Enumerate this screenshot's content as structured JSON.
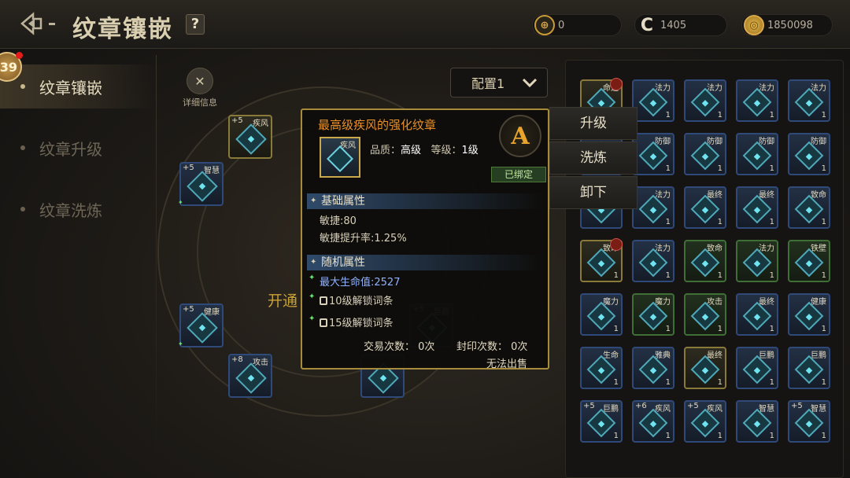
{
  "header": {
    "title": "纹章镶嵌",
    "help_label": "?",
    "currencies": [
      {
        "icon": "target-coin-icon",
        "value": "0"
      },
      {
        "icon": "c-coin-icon",
        "value": "1405"
      },
      {
        "icon": "gold-coin-icon",
        "value": "1850098"
      }
    ]
  },
  "sidebar": {
    "level_badge": "39",
    "items": [
      {
        "label": "纹章镶嵌",
        "active": true
      },
      {
        "label": "纹章升级",
        "active": false
      },
      {
        "label": "纹章洗炼",
        "active": false
      }
    ]
  },
  "main": {
    "detail_label": "详细信息",
    "config_value": "配置1",
    "unlock_text": "开通",
    "slots": [
      {
        "plus": "+5",
        "tag": "疾风"
      },
      {
        "plus": "+5",
        "tag": "智慧"
      },
      {
        "plus": "+5",
        "tag": "健康"
      },
      {
        "plus": "+8",
        "tag": "攻击"
      },
      {
        "plus": "+5",
        "tag": "巨鹏"
      }
    ]
  },
  "tooltip": {
    "name": "最高级疾风的强化纹章",
    "icon_tag": "疾风",
    "quality_label": "品质：",
    "quality_value": "高级",
    "level_label": "等级：",
    "level_value": "1级",
    "grade": "A",
    "bound": "已绑定",
    "base_title": "基础属性",
    "base_lines": [
      "敏捷:80",
      "敏捷提升率:1.25%"
    ],
    "random_title": "随机属性",
    "random_lines": [
      "最大生命值:2527",
      "10级解锁词条",
      "15级解锁词条"
    ],
    "trade_count": "交易次数： 0次",
    "seal_count": "封印次数： 0次",
    "unsellable": "无法出售"
  },
  "actions": {
    "upgrade": "升级",
    "refine": "洗炼",
    "unequip": "卸下"
  },
  "inventory": {
    "rows": [
      [
        {
          "tag": "命运",
          "cnt": "1",
          "style": "goldbr",
          "badge": true
        },
        {
          "tag": "法力",
          "cnt": "1"
        },
        {
          "tag": "法力",
          "cnt": "1"
        },
        {
          "tag": "法力",
          "cnt": "1"
        },
        {
          "tag": "法力",
          "cnt": "1"
        }
      ],
      [
        {
          "tag": "",
          "cnt": ""
        },
        {
          "tag": "防御",
          "cnt": "1"
        },
        {
          "tag": "防御",
          "cnt": "1"
        },
        {
          "tag": "防御",
          "cnt": "1"
        },
        {
          "tag": "防御",
          "cnt": "1"
        }
      ],
      [
        {
          "tag": "",
          "cnt": ""
        },
        {
          "tag": "法力",
          "cnt": "1"
        },
        {
          "tag": "最终",
          "cnt": "1"
        },
        {
          "tag": "最终",
          "cnt": "1"
        },
        {
          "tag": "致命",
          "cnt": "1"
        }
      ],
      [
        {
          "tag": "致命",
          "cnt": "1",
          "style": "goldbr",
          "badge": true
        },
        {
          "tag": "法力",
          "cnt": "1"
        },
        {
          "tag": "致命",
          "cnt": "1",
          "style": "green"
        },
        {
          "tag": "法力",
          "cnt": "1",
          "style": "green"
        },
        {
          "tag": "铁壁",
          "cnt": "1",
          "style": "green"
        }
      ],
      [
        {
          "tag": "魔力",
          "cnt": "1"
        },
        {
          "tag": "魔力",
          "cnt": "1",
          "style": "green"
        },
        {
          "tag": "攻击",
          "cnt": "1",
          "style": "green"
        },
        {
          "tag": "最终",
          "cnt": "1"
        },
        {
          "tag": "健康",
          "cnt": "1"
        }
      ],
      [
        {
          "tag": "生命",
          "cnt": "1"
        },
        {
          "tag": "雅典",
          "cnt": "1"
        },
        {
          "tag": "最终",
          "cnt": "1",
          "style": "goldbr"
        },
        {
          "tag": "巨鹏",
          "cnt": "1"
        },
        {
          "tag": "巨鹏",
          "cnt": "1"
        }
      ],
      [
        {
          "plus": "+5",
          "tag": "巨鹏",
          "cnt": "1"
        },
        {
          "plus": "+6",
          "tag": "疾风",
          "cnt": "1"
        },
        {
          "plus": "+5",
          "tag": "疾风",
          "cnt": "1"
        },
        {
          "tag": "智慧",
          "cnt": "1"
        },
        {
          "plus": "+5",
          "tag": "智慧",
          "cnt": "1"
        }
      ]
    ]
  }
}
